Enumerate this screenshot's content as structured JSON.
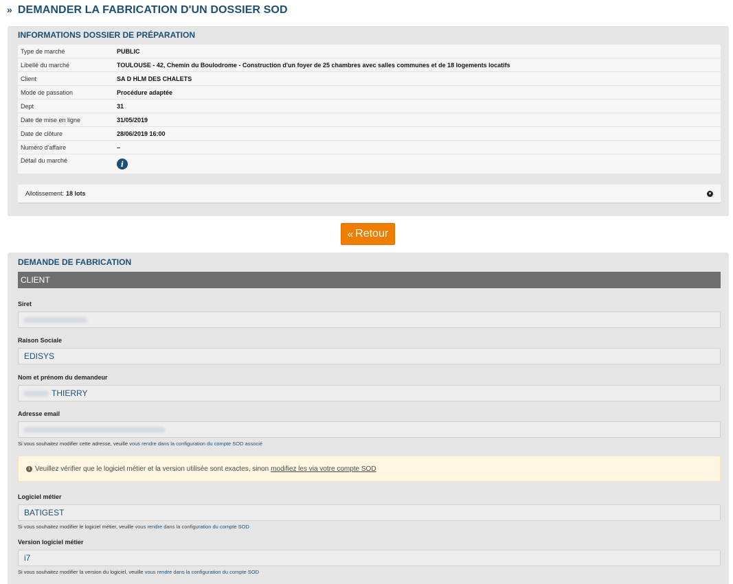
{
  "page": {
    "title": "DEMANDER LA FABRICATION D'UN DOSSIER SOD",
    "title_icon": "double-chevron-right-icon"
  },
  "info_panel": {
    "title": "INFORMATIONS DOSSIER DE PRÉPARATION",
    "rows": [
      {
        "label": "Type de marché",
        "value": "PUBLIC"
      },
      {
        "label": "Libellé du marché",
        "value": "TOULOUSE - 42, Chemin du Boulodrome - Construction d'un foyer de 25 chambres avec salles communes et de 18 logements locatifs"
      },
      {
        "label": "Client",
        "value": "SA D HLM DES CHALETS"
      },
      {
        "label": "Mode de passation",
        "value": "Procédure adaptée"
      },
      {
        "label": "Dept",
        "value": "31"
      },
      {
        "label": "Date de mise en ligne",
        "value": "31/05/2019"
      },
      {
        "label": "Date de clôture",
        "value": "28/06/2019 16:00"
      },
      {
        "label": "Numéro d'affaire",
        "value": "–"
      }
    ],
    "detail_label": "Détail du marché",
    "detail_icon": "info-circle-icon",
    "allotissement_label": "Allotissement:",
    "allotissement_value": "18 lots",
    "allotissement_icon": "chevron-down-circle-icon"
  },
  "retour_button": {
    "label": "Retour",
    "icon": "double-chevron-left-icon",
    "color": "#ef7d00"
  },
  "demande_panel": {
    "title": "DEMANDE DE FABRICATION",
    "section": "CLIENT",
    "fields": {
      "siret": {
        "label": "Siret",
        "value": ""
      },
      "raison_sociale": {
        "label": "Raison Sociale",
        "value": "EDISYS"
      },
      "nom": {
        "label": "Nom et prénom du demandeur",
        "value": "THIERRY"
      },
      "email": {
        "label": "Adresse email",
        "value": ""
      },
      "logiciel": {
        "label": "Logiciel métier",
        "value": "BATIGEST"
      },
      "version": {
        "label": "Version logiciel métier",
        "value": "i7"
      }
    },
    "hints": {
      "email_text": "Si vous souhaitez modifier cette adresse, veuille",
      "email_link": "vous rendre dans la configuration du compte SOD associé",
      "logiciel_text": "Si vous souhaitez modifier le logiciel métier, veuille",
      "logiciel_link": "vous rendre dans la configuration du compte SOD",
      "version_text": "Si vous souhaitez modifier la version du logiciel, veuille",
      "version_link": "vous rendre dans la configuration du compte SOD"
    },
    "notice": {
      "icon": "info-circle-icon",
      "text": "Veuillez vérifier que le logiciel métier et la version utilisée sont exactes, sinon",
      "link": "modifiez les via votre compte SOD"
    }
  }
}
